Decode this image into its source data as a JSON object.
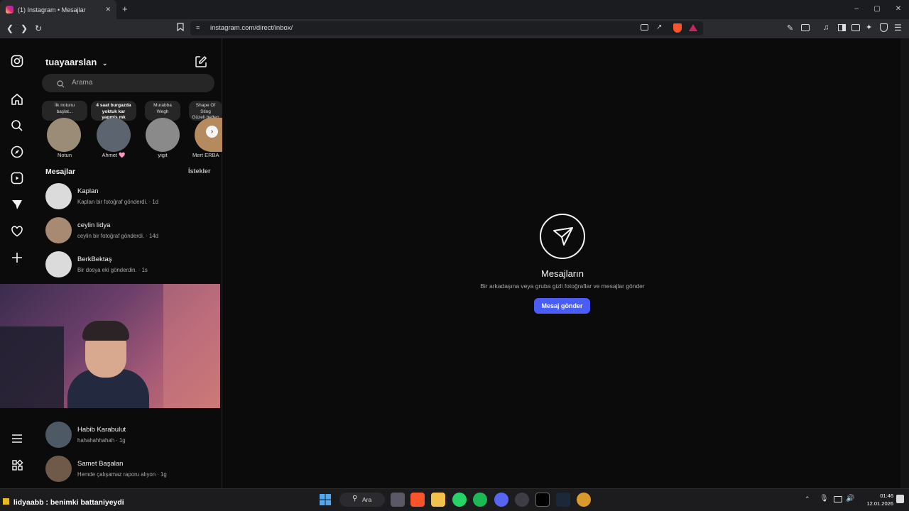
{
  "browser": {
    "tab_title": "(1) Instagram • Mesajlar",
    "new_tab": "+",
    "url": "instagram.com/direct/inbox/",
    "win_minimize": "–",
    "win_restore": "▢",
    "win_close": "✕",
    "tab_close": "✕"
  },
  "inbox": {
    "username": "tuayaarslan",
    "search_placeholder": "Arama",
    "messages_heading": "Mesajlar",
    "requests_label": "İstekler"
  },
  "notes": [
    {
      "text": "İlk notunu\nbaşlat..."
    },
    {
      "text": "4 saat burgazda\nyoktuk kar\nyagmis mk"
    },
    {
      "text": "Murabba\nWegh"
    },
    {
      "text": "Shape Of\nSting\nGüzeli beğen"
    }
  ],
  "stories": [
    {
      "name": "Notun",
      "color": "#9a8c77"
    },
    {
      "name": "Ahmet 🩷",
      "color": "#5c6470"
    },
    {
      "name": "yigit",
      "color": "#8a8a8a"
    },
    {
      "name": "Mert ERBA",
      "color": "#b58a5e"
    }
  ],
  "conversations": [
    {
      "name": "Kaplan",
      "preview": "Kaplan bir fotoğraf gönderdi. · 1d",
      "avatar_color": "#dbdbdb"
    },
    {
      "name": "ceylin lidya",
      "preview": "ceylin bir fotoğraf gönderdi. · 14d",
      "avatar_color": "#a88a72"
    },
    {
      "name": "BerkBektaş",
      "preview": "Bir dosya eki gönderdin. · 1s",
      "avatar_color": "#dbdbdb"
    },
    {
      "name": "Habib Karabulut",
      "preview": "hahahahhahah · 1g",
      "avatar_color": "#4d5a66"
    },
    {
      "name": "Samet Başalan",
      "preview": "Hemde çalışamaz raporu alıyon · 1g",
      "avatar_color": "#6f5a4a"
    }
  ],
  "empty_state": {
    "title": "Mesajların",
    "subtitle": "Bir arkadaşına veya gruba gizli fotoğraflar ve mesajlar gönder",
    "button": "Mesaj gönder"
  },
  "taskbar": {
    "chat_line": "lidyaabb : benimki battaniyeydi",
    "search_label": "Ara",
    "time": "01:46",
    "date": "12.01.2026"
  },
  "colors": {
    "accent": "#4a5df9",
    "background": "#0b0b0c"
  }
}
